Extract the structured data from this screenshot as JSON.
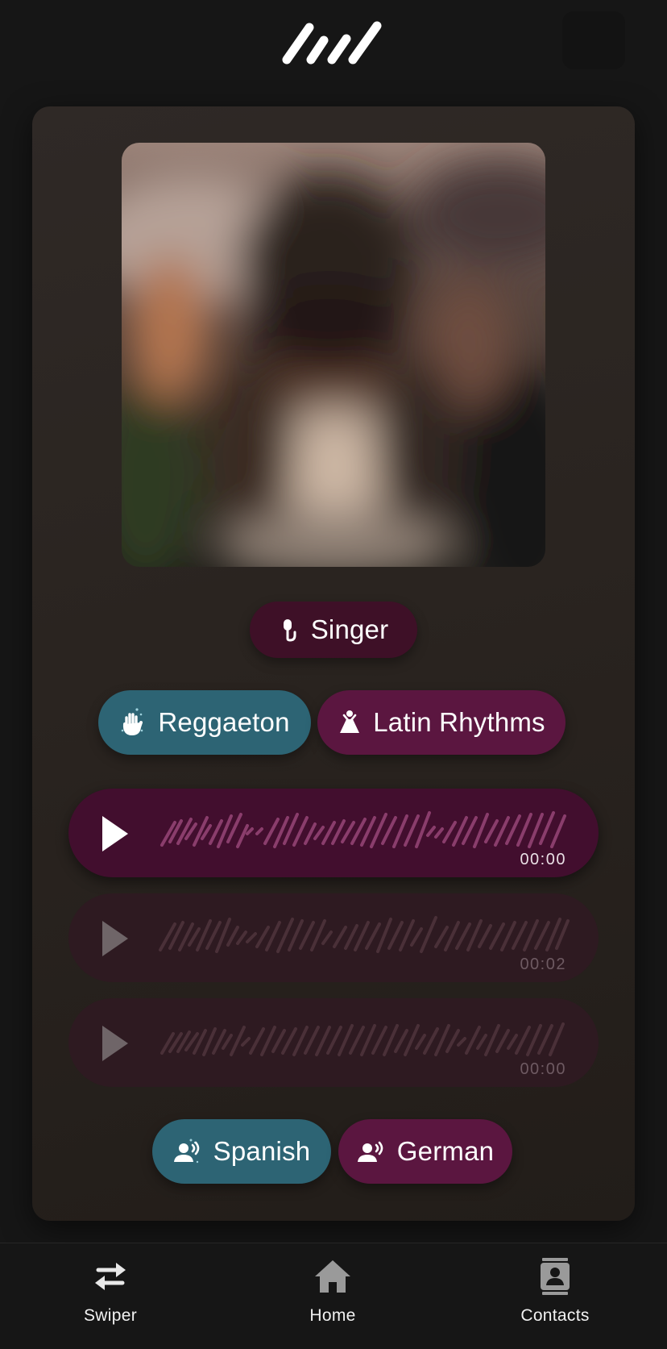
{
  "app": {
    "logo": "waveform-logo"
  },
  "profile": {
    "photo_alt": "blurred-portrait-photo",
    "role": {
      "label": "Singer",
      "icon": "microphone-icon"
    },
    "genres": [
      {
        "label": "Reggaeton",
        "icon": "hand-icon",
        "color": "#2d6474"
      },
      {
        "label": "Latin Rhythms",
        "icon": "dancer-icon",
        "color": "#5b1640"
      }
    ],
    "audio_clips": [
      {
        "time": "00:00",
        "state": "active"
      },
      {
        "time": "00:02",
        "state": "inactive"
      },
      {
        "time": "00:00",
        "state": "inactive"
      }
    ],
    "languages": [
      {
        "label": "Spanish",
        "icon": "speaking-person-icon",
        "color": "#2d6474"
      },
      {
        "label": "German",
        "icon": "speaking-person-icon",
        "color": "#5b1640"
      }
    ]
  },
  "nav": {
    "items": [
      {
        "label": "Swiper",
        "icon": "swap-arrows-icon"
      },
      {
        "label": "Home",
        "icon": "house-icon"
      },
      {
        "label": "Contacts",
        "icon": "contact-card-icon"
      }
    ]
  },
  "colors": {
    "background": "#161616",
    "accent_teal": "#2d6474",
    "accent_magenta": "#5b1640",
    "clip_active": "#420e2e",
    "clip_inactive": "#2e1a21"
  }
}
